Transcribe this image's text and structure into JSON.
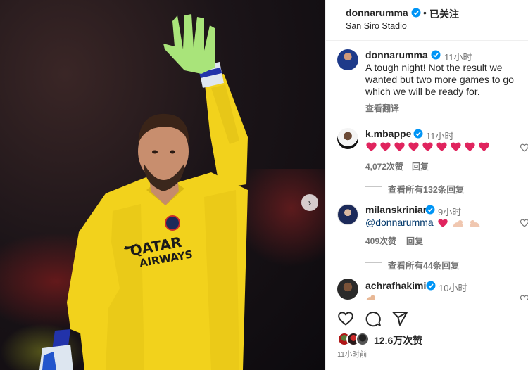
{
  "post": {
    "username": "donnarumma",
    "dot": "•",
    "follow_status": "已关注",
    "location": "San Siro Stadio"
  },
  "caption": {
    "username": "donnarumma",
    "time": "11小时",
    "lines": [
      "A tough night! Not the result we",
      "wanted but two more games to go",
      "which we will be ready for."
    ],
    "translate": "查看翻译"
  },
  "comments": [
    {
      "username": "k.mbappe",
      "time": "11小时",
      "hearts": [
        "heart-emoji",
        "heart-emoji",
        "heart-emoji",
        "heart-emoji",
        "heart-emoji",
        "heart-emoji",
        "heart-emoji",
        "heart-emoji",
        "heart-emoji"
      ],
      "likes": "4,072次赞",
      "reply_label": "回复",
      "view_replies": "查看所有132条回复"
    },
    {
      "username": "milanskriniar",
      "time": "9小时",
      "mention": "@donnarumma",
      "likes": "409次赞",
      "reply_label": "回复",
      "view_replies": "查看所有44条回复"
    },
    {
      "username": "achrafhakimi",
      "time": "10小时"
    }
  ],
  "footer": {
    "like_count": "12.6万次赞",
    "time_ago": "11小时前"
  },
  "photo": {
    "jersey_sponsor_line1": "QATAR",
    "jersey_sponsor_line2": "AIRWAYS"
  },
  "colors": {
    "jersey": "#f2d21c",
    "verified": "#0095f6",
    "heart_red": "#e0245e",
    "text": "#262626",
    "secondary_text": "#737373",
    "link": "#00376b"
  },
  "icons": {
    "next": "chevron-right-icon",
    "verified": "verified-badge-icon",
    "like": "heart-outline-icon",
    "comment": "comment-bubble-icon",
    "share": "paper-plane-icon"
  }
}
